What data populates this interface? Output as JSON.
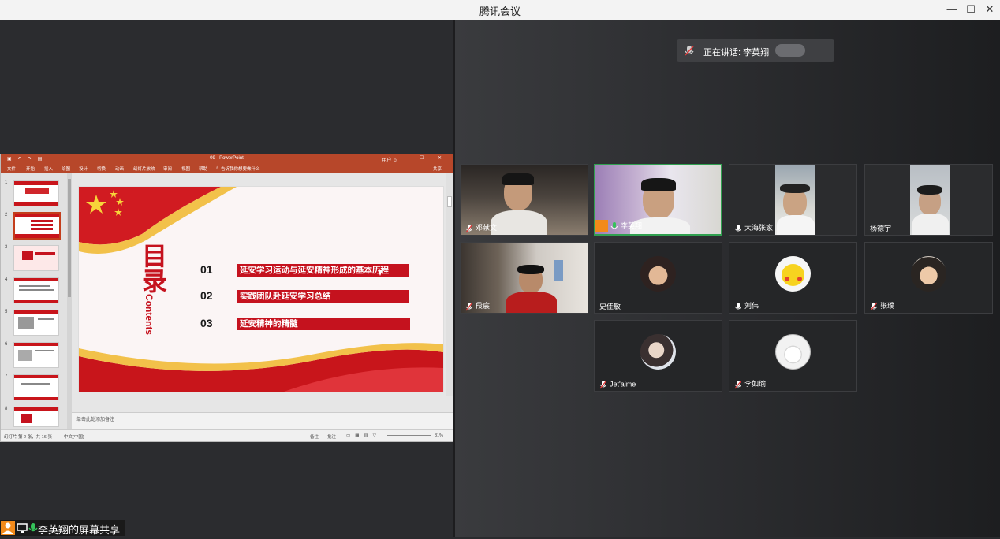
{
  "window": {
    "title": "腾讯会议",
    "minimize": "—",
    "maximize": "☐",
    "close": "✕"
  },
  "speaker": {
    "label": "正在讲话: 李英翔"
  },
  "share": {
    "label": "李英翔的屏幕共享"
  },
  "ppt": {
    "doc_title": "09 - PowerPoint",
    "account": "用户 ☺",
    "tabs": [
      "文件",
      "开始",
      "插入",
      "绘图",
      "设计",
      "切换",
      "动画",
      "幻灯片放映",
      "审阅",
      "视图",
      "帮助"
    ],
    "tell_me": "告诉我你想要做什么",
    "share_btn": "共享",
    "notes_placeholder": "单击此处添加备注",
    "status_left": "幻灯片 第 2 张，共 16 张",
    "status_lang": "中文(中国)",
    "status_notes": "备注",
    "status_comments": "批注",
    "zoom": "81%",
    "thumb_numbers": [
      "1",
      "2",
      "3",
      "4",
      "5",
      "6",
      "7",
      "8"
    ],
    "slide": {
      "heading_cn": "目录",
      "heading_en": "Contents",
      "items": [
        {
          "num": "01",
          "text": "延安学习运动与延安精神形成的基本历程"
        },
        {
          "num": "02",
          "text": "实践团队赴延安学习总结"
        },
        {
          "num": "03",
          "text": "延安精神的精髓"
        }
      ]
    }
  },
  "participants": [
    {
      "name": "邓献文"
    },
    {
      "name": "李英翔"
    },
    {
      "name": "大海张家"
    },
    {
      "name": "杨德宇"
    },
    {
      "name": "段宸"
    },
    {
      "name": "史佳敏"
    },
    {
      "name": "刘伟"
    },
    {
      "name": "张璞"
    },
    {
      "name": "Jet'aime"
    },
    {
      "name": "李如瑜"
    }
  ],
  "colors": {
    "accent_red": "#c5121e",
    "ppt_red": "#b7472a",
    "active_green": "#30a050"
  }
}
